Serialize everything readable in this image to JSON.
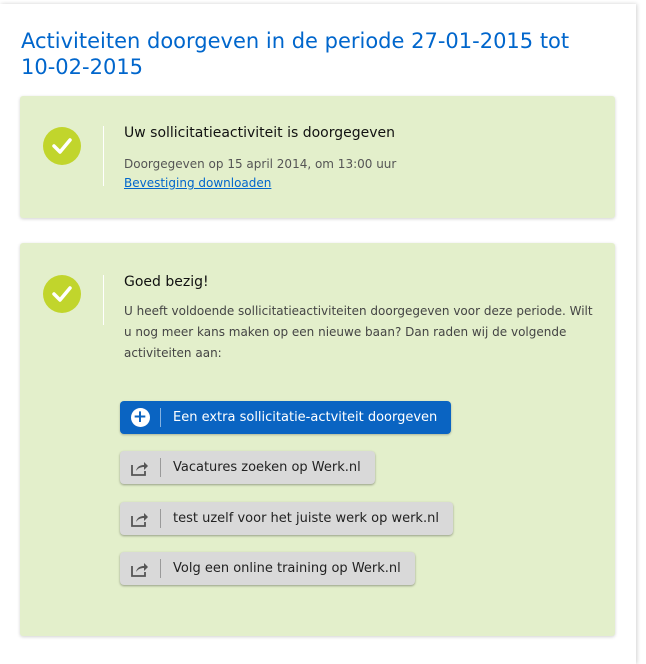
{
  "page": {
    "title": "Activiteiten doorgeven in de periode 27-01-2015 tot 10-02-2015"
  },
  "confirmation": {
    "heading": "Uw sollicitatieactiviteit is doorgegeven",
    "submitted_text": "Doorgegeven op 15 april 2014, om 13:00 uur",
    "download_link": "Bevestiging downloaden",
    "icon": "check-icon"
  },
  "advice": {
    "heading": "Goed bezig!",
    "text": "U heeft voldoende sollicitatieactiviteiten doorgegeven voor deze periode. Wilt u nog meer kans maken op een nieuwe baan? Dan raden wij de volgende activiteiten aan:",
    "icon": "check-icon"
  },
  "actions": {
    "primary": {
      "label": "Een extra sollicitatie-actviteit doorgeven",
      "icon": "plus-icon"
    },
    "secondary": [
      {
        "label": "Vacatures zoeken op Werk.nl",
        "icon": "share-icon"
      },
      {
        "label": "test uzelf voor het juiste werk op werk.nl",
        "icon": "share-icon"
      },
      {
        "label": "Volg een online training op Werk.nl",
        "icon": "share-icon"
      }
    ]
  },
  "colors": {
    "title": "#0066cc",
    "card_background": "#e3efcb",
    "check": "#c1d52c",
    "primary_button": "#0a64c2",
    "secondary_button": "#d9d9d9"
  }
}
